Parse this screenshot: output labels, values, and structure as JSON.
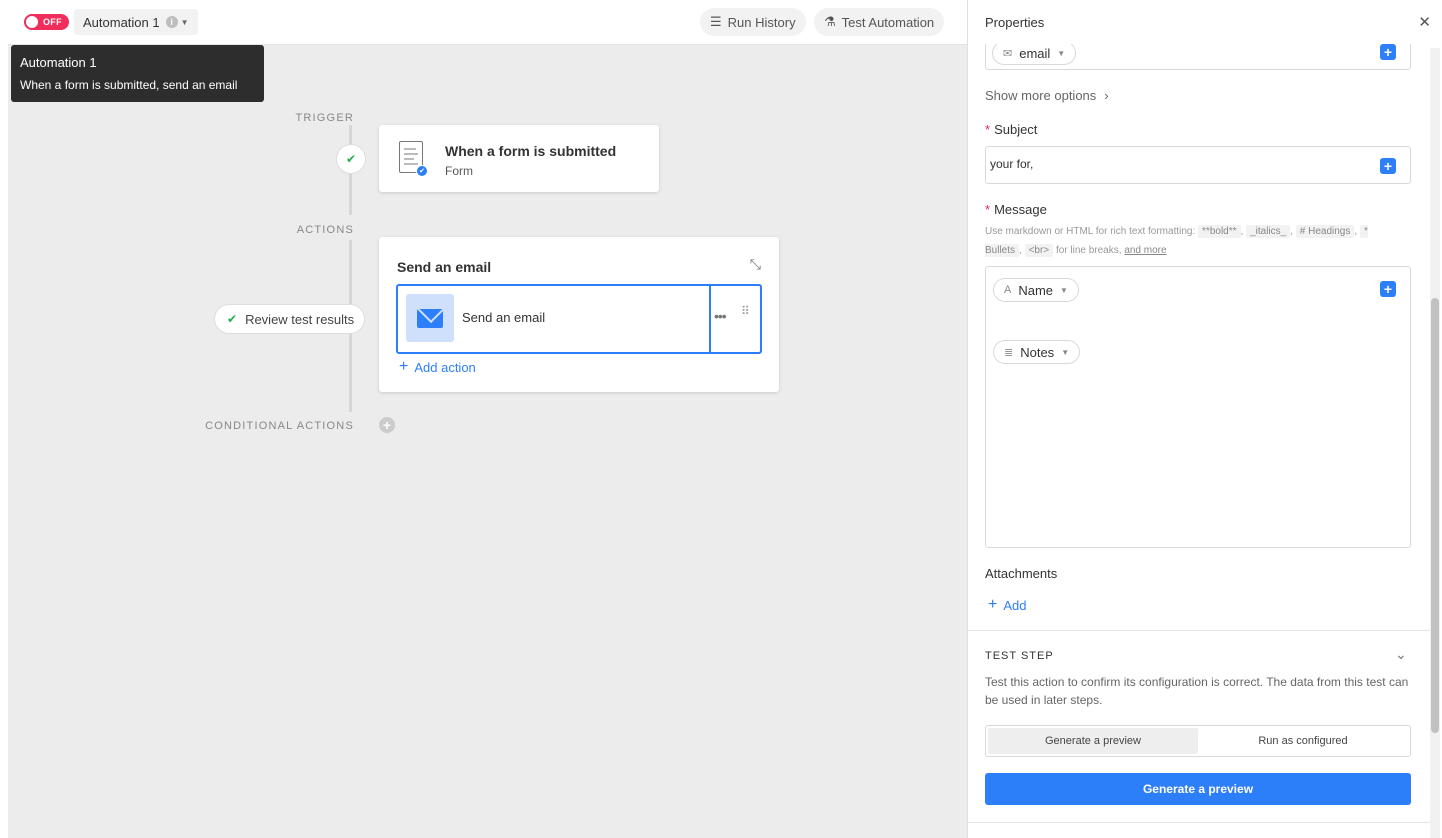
{
  "topbar": {
    "toggle_label": "OFF",
    "automation_name": "Automation 1",
    "info_icon": "info-icon",
    "run_history_label": "Run History",
    "test_automation_label": "Test Automation"
  },
  "tooltip": {
    "title": "Automation 1",
    "description": "When a form is submitted, send an email"
  },
  "canvas": {
    "trigger_label": "TRIGGER",
    "actions_label": "ACTIONS",
    "conditional_label": "CONDITIONAL ACTIONS",
    "trigger_card": {
      "title": "When a form is submitted",
      "subtitle": "Form"
    },
    "action_card": {
      "title": "Send an email",
      "step_label": "Send an email",
      "add_action_label": "Add action"
    },
    "review_label": "Review test results"
  },
  "panel": {
    "title": "Properties",
    "to_token": "email",
    "show_more_label": "Show more options",
    "subject_label": "Subject",
    "subject_value": "your for,",
    "message_label": "Message",
    "hint_pre": "Use markdown or HTML for rich text formatting:",
    "hint_codes": [
      "**bold**",
      "_italics_",
      "# Headings",
      "* Bullets",
      "<br>"
    ],
    "hint_mid": "for line breaks,",
    "hint_link": "and more",
    "message_tokens": [
      "Name",
      "Notes"
    ],
    "attachments_label": "Attachments",
    "add_label": "Add",
    "test_step_label": "TEST STEP",
    "test_description": "Test this action to confirm its configuration is correct. The data from this test can be used in later steps.",
    "segments": [
      "Generate a preview",
      "Run as configured"
    ],
    "primary_button": "Generate a preview"
  },
  "colors": {
    "accent": "#2d7ff9",
    "off_toggle": "#f02d5c",
    "success": "#21b04b",
    "canvas_bg": "#ececec"
  }
}
